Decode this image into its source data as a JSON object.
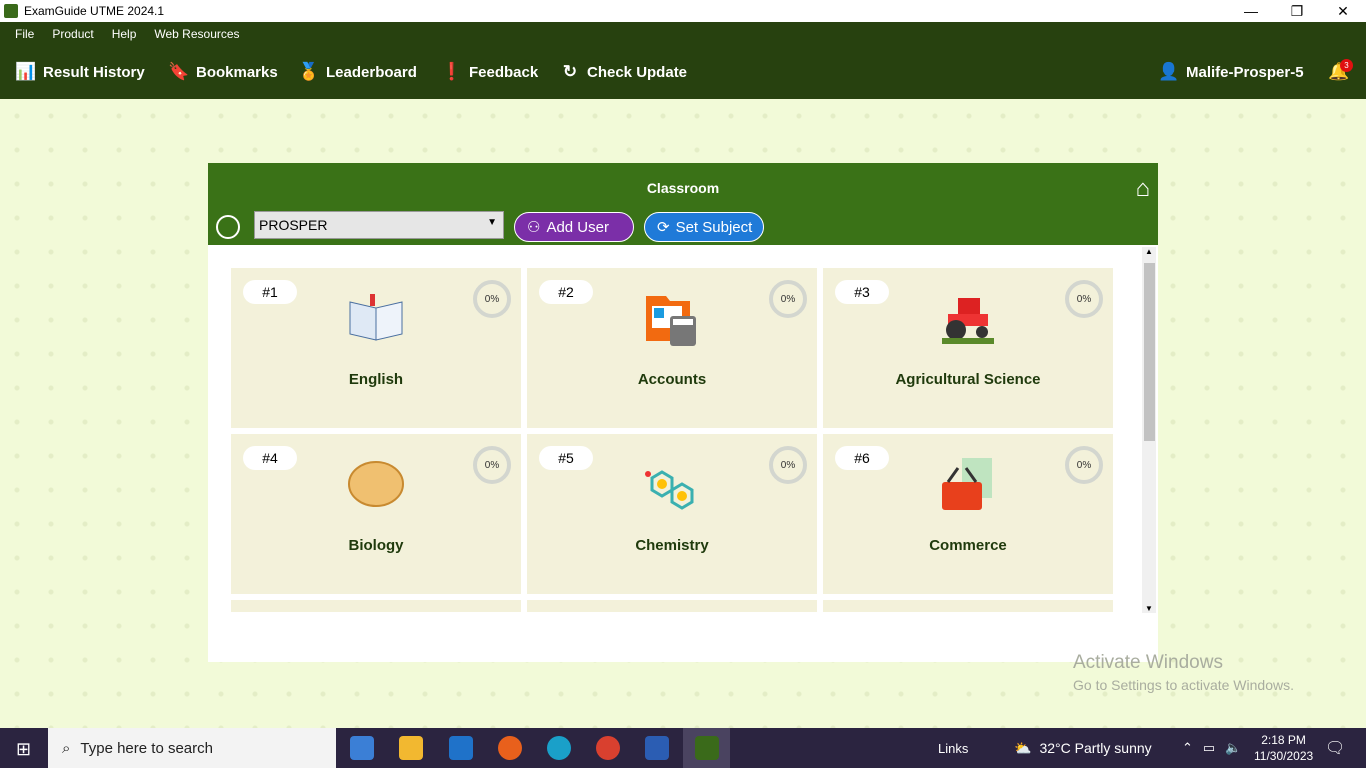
{
  "window": {
    "title": "ExamGuide UTME 2024.1",
    "minimize": "—",
    "restore": "❐",
    "close": "✕"
  },
  "menu": [
    "File",
    "Product",
    "Help",
    "Web Resources"
  ],
  "toolbar": {
    "items": [
      {
        "label": "Result History",
        "icon": "bar-chart-icon"
      },
      {
        "label": "Bookmarks",
        "icon": "bookmark-icon"
      },
      {
        "label": "Leaderboard",
        "icon": "podium-icon"
      },
      {
        "label": "Feedback",
        "icon": "feedback-icon"
      },
      {
        "label": "Check Update",
        "icon": "refresh-icon"
      }
    ],
    "user": "Malife-Prosper-5",
    "notifications": "3"
  },
  "classroom": {
    "title": "Classroom",
    "user_select": "PROSPER",
    "add_user": "Add User",
    "set_subject": "Set Subject",
    "subjects": [
      {
        "num": "#1",
        "name": "English",
        "progress": "0%"
      },
      {
        "num": "#2",
        "name": "Accounts",
        "progress": "0%"
      },
      {
        "num": "#3",
        "name": "Agricultural Science",
        "progress": "0%"
      },
      {
        "num": "#4",
        "name": "Biology",
        "progress": "0%"
      },
      {
        "num": "#5",
        "name": "Chemistry",
        "progress": "0%"
      },
      {
        "num": "#6",
        "name": "Commerce",
        "progress": "0%"
      }
    ]
  },
  "watermark": {
    "line1": "Activate Windows",
    "line2": "Go to Settings to activate Windows."
  },
  "taskbar": {
    "search_placeholder": "Type here to search",
    "links": "Links",
    "weather": "32°C  Partly sunny",
    "time": "2:18 PM",
    "date": "11/30/2023"
  },
  "colors": {
    "header": "#27410f",
    "panel_header": "#3a7217",
    "add_user": "#7b2fa8",
    "set_subject": "#1f7ad8",
    "card": "#f3f1da"
  }
}
